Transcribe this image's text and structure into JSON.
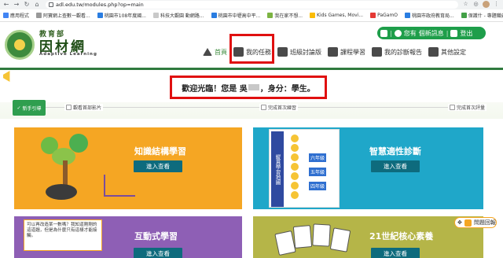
{
  "browser": {
    "url": "adl.edu.tw/modules.php?op=main",
    "bookmarks": [
      "應用程式",
      "阿寶網上查數一觀看...",
      "桃園市108年度國...",
      "科技大觀園 動網路...",
      "桃園市中壢高中平...",
      "我在家不想...",
      "Kids Games, Movi...",
      "PaGamO",
      "桃園市政府教育局...",
      "保護什 - 專題職典"
    ]
  },
  "site": {
    "logo_top": "教育部",
    "logo_main": "因材網",
    "logo_sub": "Adaptive Learning"
  },
  "header": {
    "greeting_you": "您有",
    "messages_label": "個新訊息",
    "logout": "登出"
  },
  "topnav": [
    {
      "label": "首頁"
    },
    {
      "label": "我的任務"
    },
    {
      "label": "班級討論版"
    },
    {
      "label": "課程學習"
    },
    {
      "label": "我的診斷報告"
    },
    {
      "label": "其他設定"
    }
  ],
  "welcome": {
    "prefix": "歡迎光臨！您是 吳",
    "suffix": "，身分：學生。"
  },
  "progress": {
    "newbie": "新手引導",
    "steps": [
      "觀看首部影片",
      "完成首次練習",
      "完成首次評量"
    ]
  },
  "cards": [
    {
      "title": "知識結構學習",
      "button": "進入查看"
    },
    {
      "title": "智慧適性診斷",
      "button": "進入查看"
    },
    {
      "title": "互動式學習",
      "button": "進入查看"
    },
    {
      "title": "21世紀核心素養",
      "button": "進入查看"
    }
  ],
  "card_art": {
    "teal_column": "縱貫學習地圖",
    "teal_tags": [
      "六年級",
      "五年級",
      "四年級"
    ],
    "purple_text": "可以再改造某一數嗎？我知道剛剛的這道題，但是為什麼只有這樣才能接觸。"
  },
  "floating": {
    "chat_label": "問題回報"
  },
  "colors": {
    "brand_green": "#2f7a3e",
    "orange": "#f5a623",
    "teal": "#1fa7c9",
    "purple": "#8e5fb5",
    "olive": "#b5b548",
    "highlight_red": "#e01010"
  }
}
